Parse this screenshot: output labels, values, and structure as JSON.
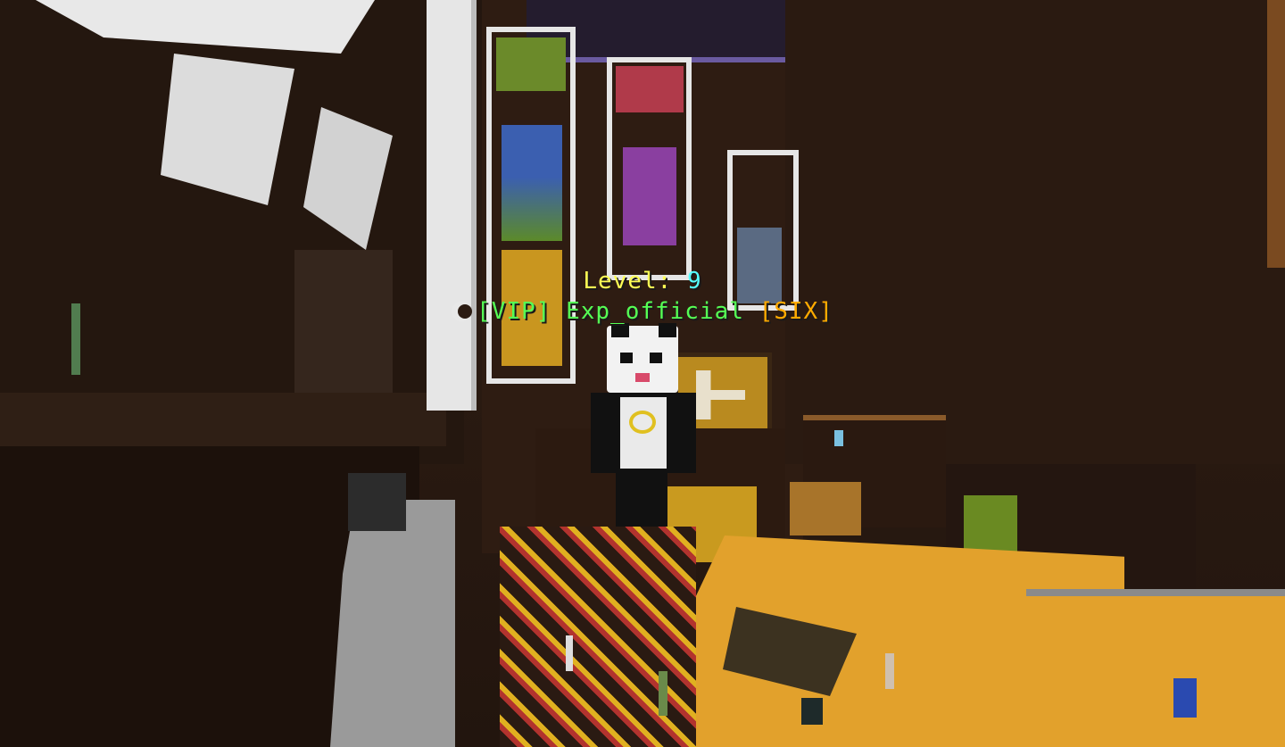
{
  "hud": {
    "level_prefix": "Level: ",
    "level_value": "9",
    "rank_tag": "[VIP]",
    "player_name": "Exp_official",
    "guild_tag": "[SIX]"
  },
  "icons": {
    "badge": "crescent-moon-icon"
  },
  "colors": {
    "level_text": "#ffff55",
    "level_number": "#55ffff",
    "rank_and_name": "#55ff55",
    "guild_tag": "#ffaa00",
    "wall_wood": "#2b1b12",
    "floor_gold": "#e7a72b",
    "quartz_white": "#e6e6e6"
  }
}
